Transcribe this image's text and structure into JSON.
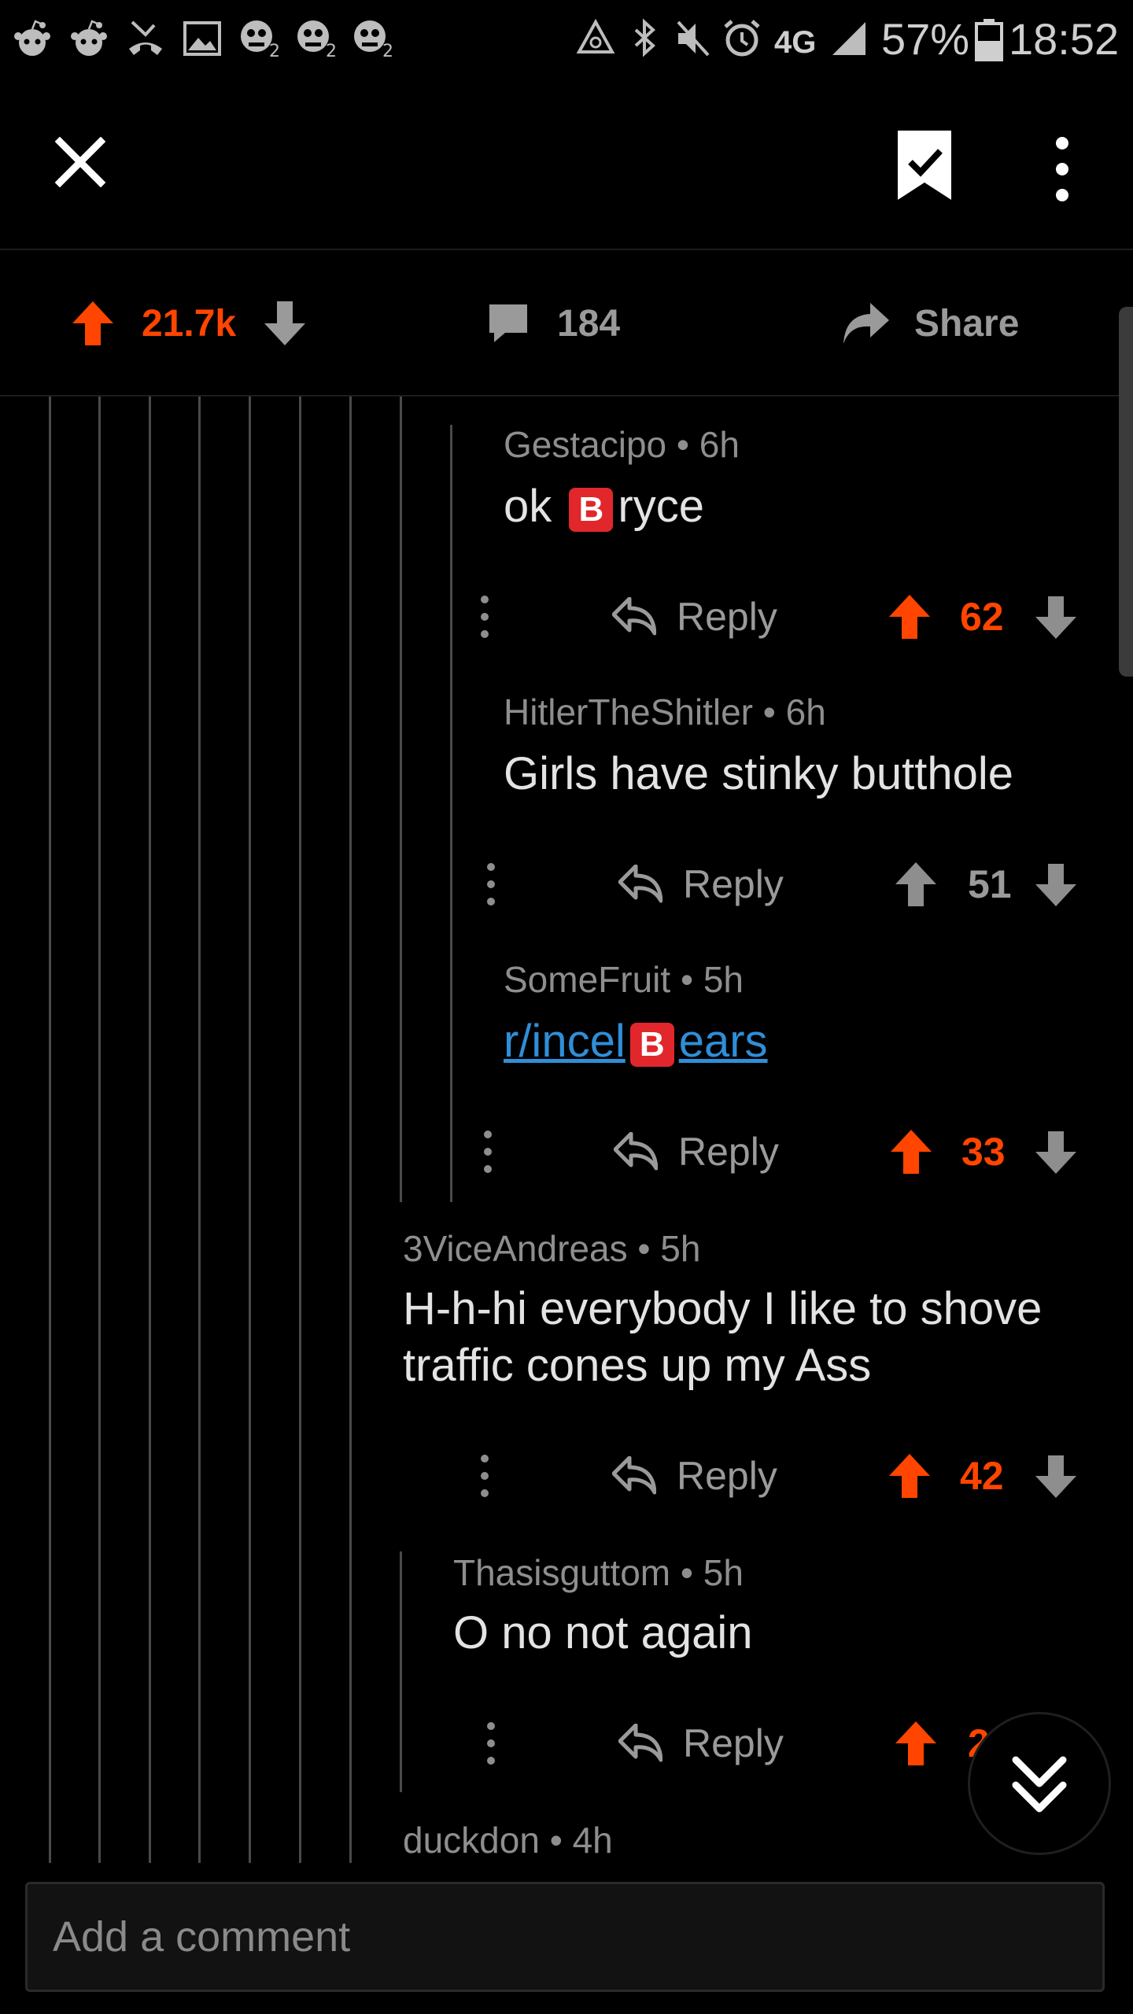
{
  "status_bar": {
    "battery_percent": "57%",
    "time": "18:52",
    "network": "4G",
    "left_icons": [
      "reddit-icon",
      "reddit-icon",
      "missed-call-icon",
      "image-icon",
      "pvz-zombie-icon",
      "pvz-zombie-icon",
      "pvz-zombie-icon"
    ],
    "right_icons": [
      "recycle-icon",
      "bluetooth-icon",
      "mute-icon",
      "alarm-icon",
      "network-4g-icon",
      "signal-icon",
      "battery-icon"
    ]
  },
  "action_bar": {
    "upvotes": "21.7k",
    "comments": "184",
    "share_label": "Share"
  },
  "comments": [
    {
      "author": "Gestacipo",
      "age": "6h",
      "body_before": "ok ",
      "emoji": "B",
      "body_after": "ryce",
      "votes": "62",
      "upvoted": true
    },
    {
      "author": "HitlerTheShitler",
      "age": "6h",
      "body": "Girls have stinky butthole",
      "votes": "51",
      "upvoted": false
    },
    {
      "author": "SomeFruit",
      "age": "5h",
      "body_before": "r/incel",
      "emoji": "B",
      "body_after": "ears",
      "votes": "33",
      "upvoted": true,
      "is_link": true
    },
    {
      "author": "3ViceAndreas",
      "age": "5h",
      "body_line1": "H-h-hi everybody I like to shove",
      "body_line2": "traffic cones up my Ass",
      "votes": "42",
      "upvoted": true
    },
    {
      "author": "Thasisguttom",
      "age": "5h",
      "body": "O no not again",
      "votes": "2",
      "upvoted": true
    },
    {
      "author": "duckdon",
      "age": "4h"
    }
  ],
  "reply_label": "Reply",
  "comment_input": {
    "placeholder": "Add a comment"
  },
  "colors": {
    "accent": "#ff4500",
    "link": "#2f8ed8",
    "background": "#000000"
  }
}
